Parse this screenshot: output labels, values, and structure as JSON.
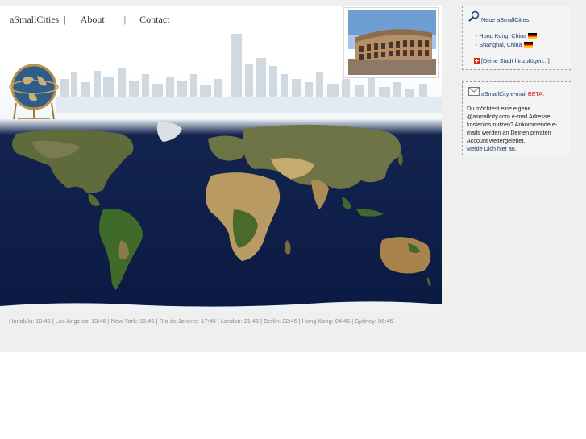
{
  "nav": {
    "brand": "aSmallCities",
    "sep1": "|",
    "about": "About",
    "sep2": "|",
    "contact": "Contact"
  },
  "header": {
    "photo_alt": "Colosseum, Rome",
    "map_alt": "World map"
  },
  "world_times": "Honolulu: 10:46 | Los Angeles: 13:46 | New York: 16:46 | Rio de Janeiro: 17:46 | London: 21:46 | Berlin: 22:46 | Hong Kong: 04:46 | Sydney: 06:46",
  "new_cities": {
    "title": "Neue aSmallCities:",
    "items": [
      "- Hong Kong, China",
      "- Shanghai, China"
    ],
    "add_link": "[Deine Stadt hinzufügen...]"
  },
  "email_box": {
    "title": "aSmallCity e-mail",
    "beta": "BETA:",
    "text": "Du möchtest eine eigene @asmallcity.com e-mail Adresse kostenlos nutzen? Ankommende e-mails werden an Deinen privaten Account weitergeleitet.",
    "signup": "Melde Dich hier an."
  },
  "colors": {
    "band": "#efefef",
    "link": "#1a3a6b",
    "beta": "#cc1111",
    "ocean": "#0d1f4a"
  },
  "icons": {
    "search": "magnifier-icon",
    "email": "envelope-icon",
    "ch_flag": "swiss-flag-icon",
    "de_flag": "german-flag-icon"
  }
}
